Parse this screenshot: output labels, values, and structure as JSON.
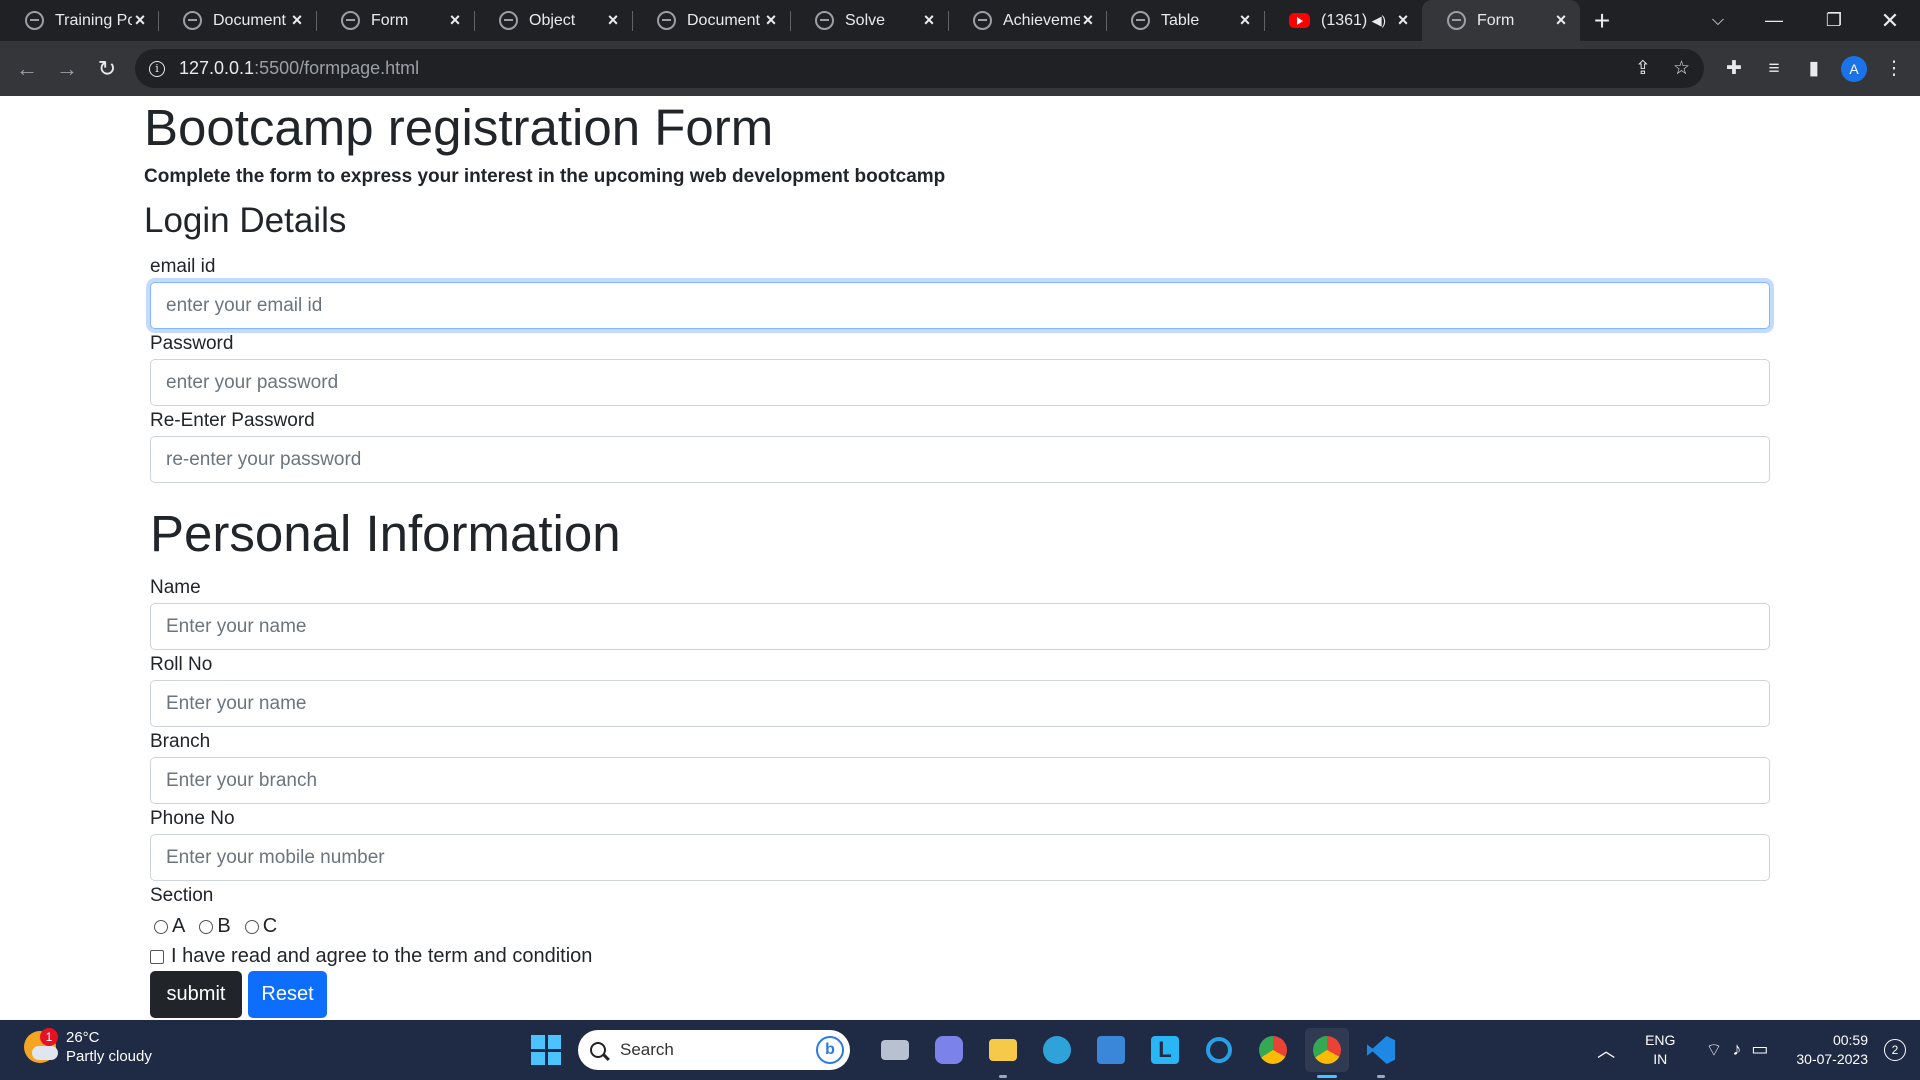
{
  "browser": {
    "tabs": [
      {
        "title": "Training Por",
        "favicon": "globe-icon"
      },
      {
        "title": "Document",
        "favicon": "globe-icon"
      },
      {
        "title": "Form",
        "favicon": "globe-icon"
      },
      {
        "title": "Object",
        "favicon": "globe-icon"
      },
      {
        "title": "Document",
        "favicon": "globe-icon"
      },
      {
        "title": "Solve",
        "favicon": "globe-icon"
      },
      {
        "title": "Achievemer",
        "favicon": "globe-icon"
      },
      {
        "title": "Table",
        "favicon": "globe-icon"
      },
      {
        "title": "(1361)",
        "favicon": "youtube-icon",
        "audio": true
      },
      {
        "title": "Form",
        "favicon": "globe-icon",
        "active": true
      }
    ],
    "url_host": "127.0.0.1",
    "url_path": ":5500/formpage.html",
    "profile_initial": "A"
  },
  "page": {
    "title": "Bootcamp registration Form",
    "subtitle": "Complete the form to express your interest in the upcoming web development bootcamp",
    "login_heading": "Login Details",
    "personal_heading": "Personal Information",
    "fields": {
      "email": {
        "label": "email id",
        "placeholder": "enter your email id",
        "value": ""
      },
      "password": {
        "label": "Password",
        "placeholder": "enter your password",
        "value": ""
      },
      "repassword": {
        "label": "Re-Enter Password",
        "placeholder": "re-enter your password",
        "value": ""
      },
      "name": {
        "label": "Name",
        "placeholder": "Enter your name",
        "value": ""
      },
      "rollno": {
        "label": "Roll No",
        "placeholder": "Enter your name",
        "value": ""
      },
      "branch": {
        "label": "Branch",
        "placeholder": "Enter your branch",
        "value": ""
      },
      "phone": {
        "label": "Phone No",
        "placeholder": "Enter your mobile number",
        "value": ""
      }
    },
    "section": {
      "label": "Section",
      "options": [
        "A",
        "B",
        "C"
      ]
    },
    "terms_label": "I have read and agree to the term and condition",
    "submit_label": "submit",
    "reset_label": "Reset"
  },
  "taskbar": {
    "weather_temp": "26°C",
    "weather_desc": "Partly cloudy",
    "weather_badge": "1",
    "search_label": "Search",
    "lang_line1": "ENG",
    "lang_line2": "IN",
    "time": "00:59",
    "date": "30-07-2023",
    "notification_count": "2"
  },
  "colors": {
    "tabstrip": "#202124",
    "toolbar": "#35363a",
    "primary": "#0d6efd",
    "dark": "#212529",
    "taskbar": "#1f2a44"
  }
}
